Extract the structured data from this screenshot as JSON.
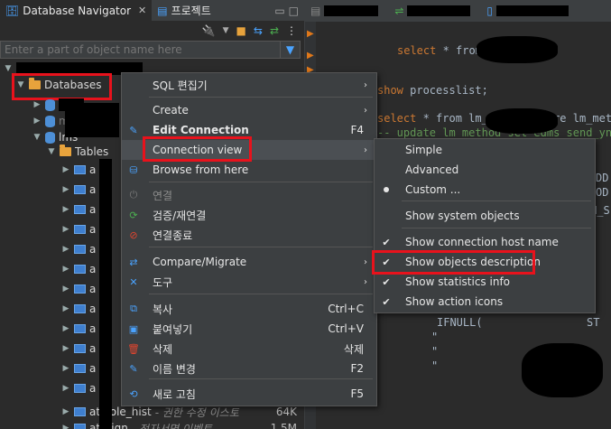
{
  "nav_tabs": [
    {
      "label": "Database Navigator",
      "close": "✕"
    },
    {
      "label": "프로젝트",
      "close": ""
    }
  ],
  "filter": {
    "placeholder": "Enter a part of object name here"
  },
  "tree": {
    "databases_label": "Databases",
    "tables_label": "Tables",
    "db_item_partial": "mo",
    "db_item_partial2": "lms",
    "table_prefix": "a",
    "table_hist": "at_role_hist",
    "table_hist_desc": "- 권한 수정 이스토",
    "table_hist_size": "64K",
    "table_sign": "at_sign",
    "table_sign_desc": "- 전자서명 이벤트",
    "table_sign_size": "1.5M"
  },
  "editor": {
    "lines": [
      {
        "kw": "select",
        "rest": " * from lm_method;"
      },
      {
        "kw": "show",
        "rest": " processlist;"
      },
      {
        "kw": "select",
        "rest": " * from lm_method where lm_method"
      },
      {
        "kw": "",
        "rest": "-- update lm_method set edms_send_yn='"
      }
    ],
    "right_partials": [
      "DD",
      "OD",
      "M_S"
    ],
    "bottom_partials": [
      "IFNULL(",
      "ST",
      "\"",
      "\"",
      "\""
    ]
  },
  "context_menu": {
    "items": [
      {
        "label": "SQL 편집기",
        "short": "",
        "arrow": "›"
      },
      {
        "label": "Create",
        "short": "",
        "arrow": "›"
      },
      {
        "label": "Edit Connection",
        "short": "F4",
        "arrow": ""
      },
      {
        "label": "Connection view",
        "short": "",
        "arrow": "›"
      },
      {
        "label": "Browse from here",
        "short": "",
        "arrow": ""
      },
      {
        "label": "연결",
        "short": "",
        "arrow": ""
      },
      {
        "label": "검증/재연결",
        "short": "",
        "arrow": ""
      },
      {
        "label": "연결종료",
        "short": "",
        "arrow": ""
      },
      {
        "label": "Compare/Migrate",
        "short": "",
        "arrow": "›"
      },
      {
        "label": "도구",
        "short": "",
        "arrow": "›"
      },
      {
        "label": "복사",
        "short": "Ctrl+C",
        "arrow": ""
      },
      {
        "label": "붙여넣기",
        "short": "Ctrl+V",
        "arrow": ""
      },
      {
        "label": "삭제",
        "short": "삭제",
        "arrow": ""
      },
      {
        "label": "이름 변경",
        "short": "F2",
        "arrow": ""
      },
      {
        "label": "새로 고침",
        "short": "F5",
        "arrow": ""
      }
    ]
  },
  "sub_menu": {
    "items": [
      {
        "label": "Simple",
        "checked": false
      },
      {
        "label": "Advanced",
        "checked": false
      },
      {
        "label": "Custom ...",
        "checked": false
      },
      {
        "label": "Show system objects",
        "checked": false
      },
      {
        "label": "Show connection host name",
        "checked": true
      },
      {
        "label": "Show objects description",
        "checked": true
      },
      {
        "label": "Show statistics info",
        "checked": true
      },
      {
        "label": "Show action icons",
        "checked": true
      }
    ],
    "check_glyph": "✔"
  },
  "colors": {
    "highlight": "#e8121c",
    "accent": "#4aa3ff",
    "folder": "#e8a33c"
  }
}
